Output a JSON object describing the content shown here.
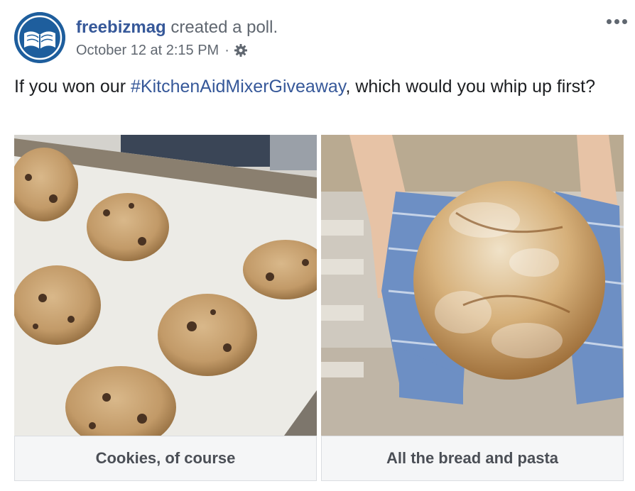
{
  "post": {
    "page_name": "freebizmag",
    "action": "created a poll.",
    "timestamp": "October 12 at 2:15 PM",
    "separator": "·",
    "privacy_icon": "gear-icon",
    "more_icon": "more-options-icon",
    "avatar_icon": "open-book-logo"
  },
  "question": {
    "before": "If you won our ",
    "hashtag": "#KitchenAidMixerGiveaway",
    "after": ", which would you whip up first?"
  },
  "poll": {
    "options": [
      {
        "label": "Cookies, of course",
        "image": "cookie-dough-on-baking-sheet"
      },
      {
        "label": "All the bread and pasta",
        "image": "round-bread-loaf-in-towel"
      }
    ]
  },
  "colors": {
    "link": "#365899",
    "secondary_text": "#606770",
    "option_bg": "#f5f6f7",
    "avatar_bg": "#1e5e9d"
  }
}
